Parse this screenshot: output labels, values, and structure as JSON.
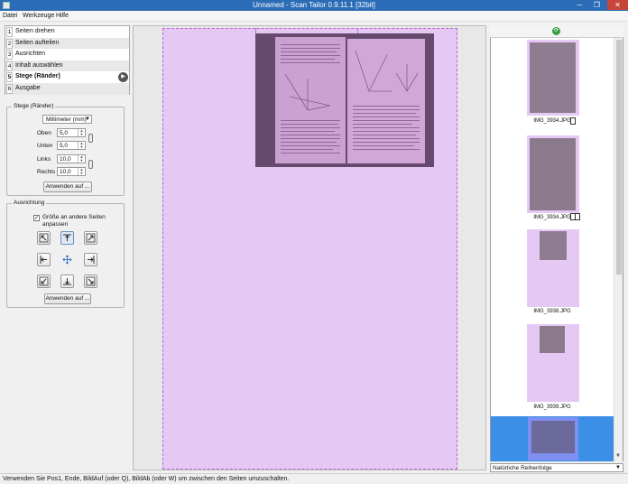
{
  "window": {
    "title": "Unnamed - Scan Tailor 0.9.11.1 [32bit]",
    "minimize": "─",
    "maximize": "❐",
    "close": "✕"
  },
  "menu": {
    "file": "Datei",
    "tools": "Werkzeuge",
    "help": "Hilfe"
  },
  "steps": [
    {
      "num": "1",
      "label": "Seiten drehen"
    },
    {
      "num": "2",
      "label": "Seiten aufteilen"
    },
    {
      "num": "3",
      "label": "Ausrichten"
    },
    {
      "num": "4",
      "label": "Inhalt auswählen"
    },
    {
      "num": "5",
      "label": "Stege (Ränder)"
    },
    {
      "num": "6",
      "label": "Ausgabe"
    }
  ],
  "margins": {
    "title": "Stege (Ränder)",
    "unit": "Millimeter (mm)",
    "top_label": "Oben",
    "top": "5,0",
    "bottom_label": "Unten",
    "bottom": "5,0",
    "left_label": "Links",
    "left": "10,0",
    "right_label": "Rechts",
    "right": "10,0",
    "apply": "Anwenden auf ..."
  },
  "alignment": {
    "title": "Ausrichtung",
    "match_size_checked": "✓",
    "match_size_line1": "Größe an andere Seiten",
    "match_size_line2": "anpassen",
    "apply": "Anwenden auf ..."
  },
  "thumbnails": [
    {
      "label": "IMG_3934.JPG"
    },
    {
      "label": "IMG_3934.JPG"
    },
    {
      "label": "IMG_3938.JPG"
    },
    {
      "label": "IMG_3939.JPG"
    },
    {
      "label": ""
    }
  ],
  "sort_order": "Natürliche Reihenfolge",
  "status": "Verwenden Sie Pos1, Ende, BildAuf (oder Q), BildAb (oder W) um zwischen den Seiten umzuschalten.",
  "colors": {
    "titlebar": "#2b6cb7",
    "page_zone": "#e6c8f4",
    "selection": "#3b8fe6"
  }
}
